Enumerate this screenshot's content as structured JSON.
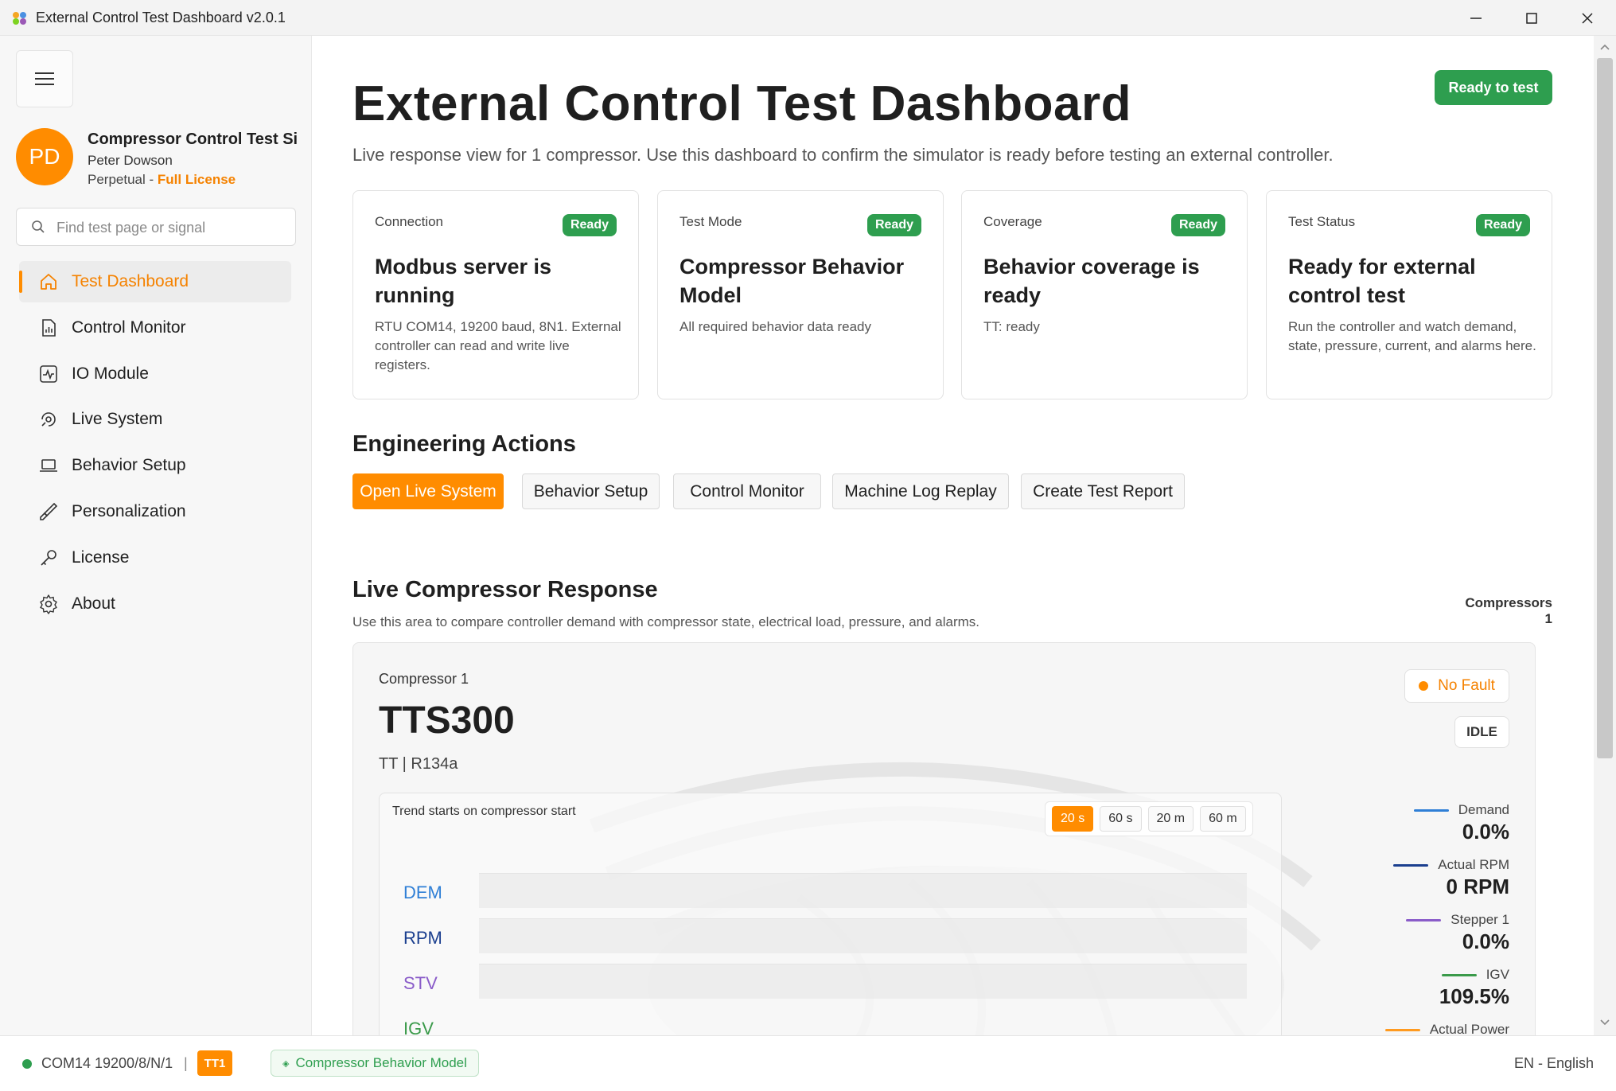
{
  "window": {
    "title": "External Control Test Dashboard v2.0.1"
  },
  "sidebar": {
    "profile": {
      "initials": "PD",
      "app_name": "Compressor Control Test Simulator",
      "user": "Peter Dowson",
      "license_type": "Perpetual - ",
      "license_level": "Full License"
    },
    "search": {
      "placeholder": "Find test page or signal"
    },
    "items": [
      {
        "label": "Test Dashboard",
        "icon": "home-icon",
        "active": true
      },
      {
        "label": "Control Monitor",
        "icon": "report-icon"
      },
      {
        "label": "IO Module",
        "icon": "pulse-icon"
      },
      {
        "label": "Live System",
        "icon": "live-icon"
      },
      {
        "label": "Behavior Setup",
        "icon": "laptop-icon"
      },
      {
        "label": "Personalization",
        "icon": "brush-icon"
      },
      {
        "label": "License",
        "icon": "key-icon"
      },
      {
        "label": "About",
        "icon": "gear-icon"
      }
    ]
  },
  "header": {
    "title": "External Control Test Dashboard",
    "subtitle": "Live response view for 1 compressor. Use this dashboard to confirm the simulator is ready before testing an external controller.",
    "status_button": "Ready to test"
  },
  "cards": [
    {
      "label": "Connection",
      "badge": "Ready",
      "title": "Modbus server is running",
      "desc": "RTU COM14, 19200 baud, 8N1. External controller can read and write live registers."
    },
    {
      "label": "Test Mode",
      "badge": "Ready",
      "title": "Compressor Behavior Model",
      "desc": "All required behavior data ready"
    },
    {
      "label": "Coverage",
      "badge": "Ready",
      "title": "Behavior coverage is ready",
      "desc": "TT: ready"
    },
    {
      "label": "Test Status",
      "badge": "Ready",
      "title": "Ready for external control test",
      "desc": "Run the controller and watch demand, state, pressure, current, and alarms here."
    }
  ],
  "engineering": {
    "title": "Engineering Actions",
    "actions": [
      "Open Live System",
      "Behavior Setup",
      "Control Monitor",
      "Machine Log Replay",
      "Create Test Report"
    ]
  },
  "live": {
    "title": "Live Compressor Response",
    "subtitle": "Use this area to compare controller demand with compressor state, electrical load, pressure, and alarms.",
    "count_label": "Compressors 1",
    "compressor": {
      "label": "Compressor 1",
      "model": "TTS300",
      "meta": "TT  |  R134a",
      "fault": "No Fault",
      "state": "IDLE",
      "trend_title": "Trend starts on compressor start",
      "ranges": [
        "20 s",
        "60 s",
        "20 m",
        "60 m"
      ],
      "active_range": "20 s",
      "tracks": [
        {
          "label": "DEM",
          "color": "#2f7fd6"
        },
        {
          "label": "RPM",
          "color": "#1b3f8f"
        },
        {
          "label": "STV",
          "color": "#8a5cc9"
        },
        {
          "label": "IGV",
          "color": "#3a9a4a"
        }
      ],
      "legend": [
        {
          "name": "Demand",
          "value": "0.0%",
          "color": "#2f7fd6"
        },
        {
          "name": "Actual RPM",
          "value": "0 RPM",
          "color": "#1b3f8f"
        },
        {
          "name": "Stepper 1",
          "value": "0.0%",
          "color": "#8a5cc9"
        },
        {
          "name": "IGV",
          "value": "109.5%",
          "color": "#3a9a4a"
        },
        {
          "name": "Actual Power",
          "value": "",
          "color": "#ff9a1f"
        }
      ]
    }
  },
  "statusbar": {
    "port": "COM14 19200/8/N/1",
    "separator": "|",
    "tt_badge": "TT1",
    "mode": "Compressor Behavior Model",
    "language": "EN - English"
  },
  "colors": {
    "accent": "#ff8c00",
    "ready": "#2e9e4f"
  }
}
